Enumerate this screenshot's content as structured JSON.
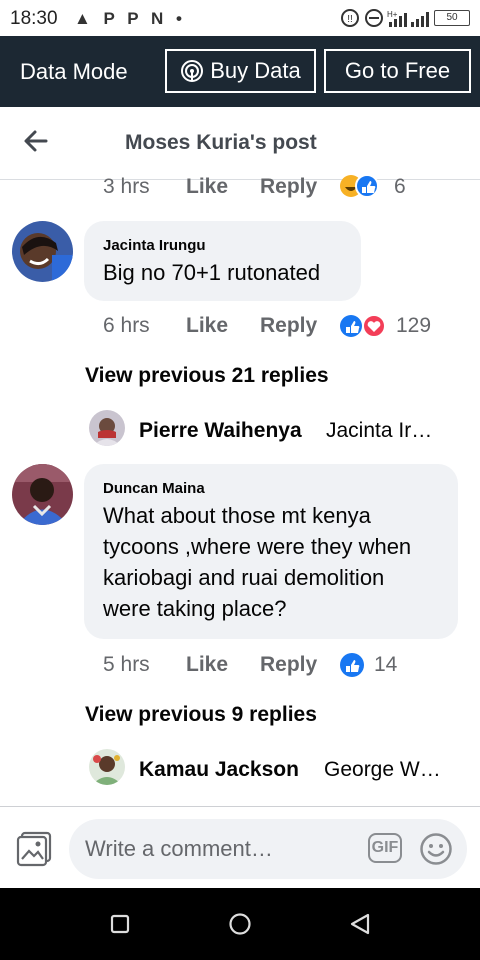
{
  "status_bar": {
    "time": "18:30",
    "notification_icons": "▲ P P N •",
    "battery": "50"
  },
  "mode_bar": {
    "label": "Data Mode",
    "buy_data": "Buy Data",
    "go_free": "Go to Free"
  },
  "header": {
    "title": "Moses Kuria's post"
  },
  "top_partial": {
    "time": "3 hrs",
    "like": "Like",
    "reply": "Reply",
    "reaction_count": "6"
  },
  "comments": [
    {
      "author": "Jacinta Irungu",
      "text": "Big no 70+1 rutonated",
      "time": "6 hrs",
      "like": "Like",
      "reply": "Reply",
      "reaction_count": "129",
      "view_previous": "View previous 21 replies",
      "reply_author": "Pierre Waihenya",
      "reply_snippet": "Jacinta Ir…"
    },
    {
      "author": "Duncan Maina",
      "text_lines": [
        "What about those mt kenya",
        "tycoons ,where were they when",
        "kariobagi and ruai demolition",
        "were taking place?"
      ],
      "time": "5 hrs",
      "like": "Like",
      "reply": "Reply",
      "reaction_count": "14",
      "view_previous": "View previous 9 replies",
      "reply_author": "Kamau Jackson",
      "reply_snippet": "George W…"
    }
  ],
  "composer": {
    "placeholder": "Write a comment…",
    "gif_label": "GIF"
  },
  "colors": {
    "mode_bar": "#1c2833",
    "like_blue": "#1877f2",
    "love_red": "#f33e58",
    "bubble": "#f0f2f5"
  }
}
